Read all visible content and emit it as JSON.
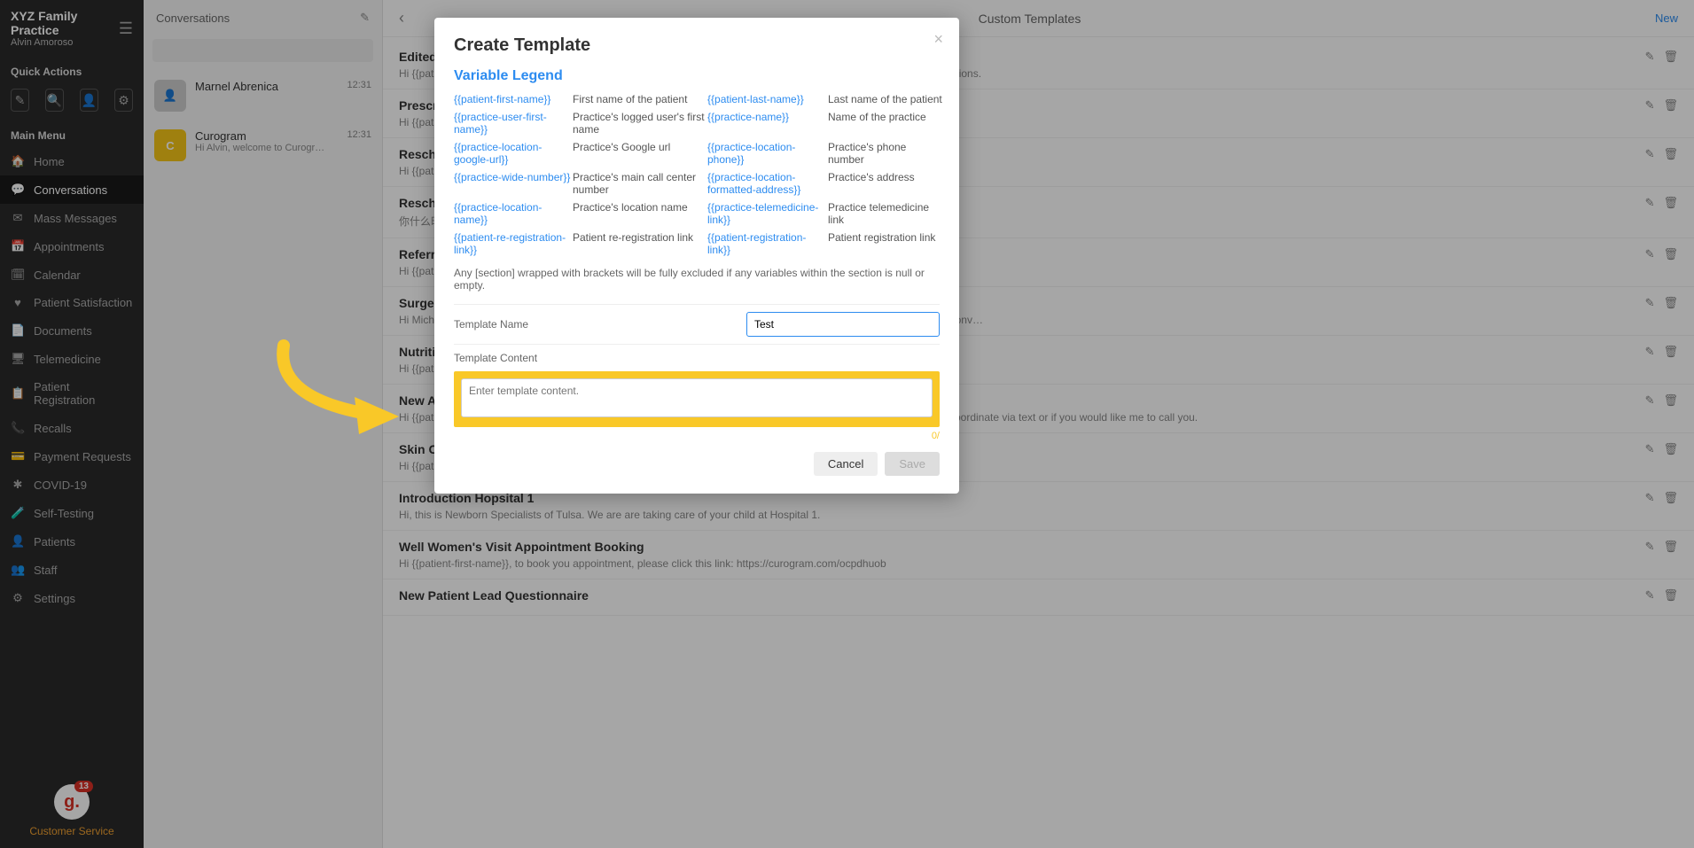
{
  "sidebar": {
    "practice": "XYZ Family Practice",
    "user": "Alvin Amoroso",
    "quick_actions_label": "Quick Actions",
    "main_menu_label": "Main Menu",
    "items": [
      {
        "icon": "🏠",
        "label": "Home"
      },
      {
        "icon": "💬",
        "label": "Conversations"
      },
      {
        "icon": "✉",
        "label": "Mass Messages"
      },
      {
        "icon": "📅",
        "label": "Appointments"
      },
      {
        "icon": "🗓",
        "label": "Calendar"
      },
      {
        "icon": "♥",
        "label": "Patient Satisfaction"
      },
      {
        "icon": "📄",
        "label": "Documents"
      },
      {
        "icon": "🖥",
        "label": "Telemedicine"
      },
      {
        "icon": "📋",
        "label": "Patient Registration"
      },
      {
        "icon": "📞",
        "label": "Recalls"
      },
      {
        "icon": "💳",
        "label": "Payment Requests"
      },
      {
        "icon": "✱",
        "label": "COVID-19"
      },
      {
        "icon": "🧪",
        "label": "Self-Testing"
      },
      {
        "icon": "👤",
        "label": "Patients"
      },
      {
        "icon": "👥",
        "label": "Staff"
      },
      {
        "icon": "⚙",
        "label": "Settings"
      }
    ],
    "badge_count": "13",
    "cs_label": "Customer Service"
  },
  "conversations": {
    "title": "Conversations",
    "search_placeholder": "",
    "items": [
      {
        "name": "Marnel Abrenica",
        "snippet": "",
        "time": "12:31",
        "avatar_type": "photo"
      },
      {
        "name": "Curogram",
        "snippet": "Hi Alvin, welcome to Curogr…",
        "time": "12:31",
        "avatar_type": "yellow",
        "avatar_letter": "C"
      }
    ]
  },
  "main": {
    "title": "Custom Templates",
    "new_label": "New"
  },
  "templates": [
    {
      "title": "Edited T",
      "preview": "Hi {{patient… reply back to this message if you have any questions. Please reply to this message if you have any questions."
    },
    {
      "title": "Prescri",
      "preview": "Hi {{patie…"
    },
    {
      "title": "Resched",
      "preview": "Hi {{patie…"
    },
    {
      "title": "Resched",
      "preview": "你什么时…"
    },
    {
      "title": "Referral",
      "preview": "Hi {{patie…"
    },
    {
      "title": "Surgery",
      "preview": "Hi Michae… …ole is $XXX, and your out-of-pocket is $XXX. I will be sending you a payment request via text for your conv…"
    },
    {
      "title": "Nutritio",
      "preview": "Hi {{patie…"
    },
    {
      "title": "New Ap",
      "preview": "Hi {{patient-first-name}}, Dr. Mote would like you to schedule an appointment. Please let me know if you would like to coordinate via text or if you would like me to call you."
    },
    {
      "title": "Skin Care Post Visit Instructions",
      "preview": "Hi {{patient-first-name}}, please see the link here for instructions on your skin care: WWW"
    },
    {
      "title": "Introduction Hopsital 1",
      "preview": "Hi, this is Newborn Specialists of Tulsa. We are are taking care of your child at Hospital 1."
    },
    {
      "title": "Well Women's Visit Appointment Booking",
      "preview": "Hi {{patient-first-name}}, to book you appointment, please click this link:  https://curogram.com/ocpdhuob"
    },
    {
      "title": "New Patient Lead Questionnaire",
      "preview": ""
    }
  ],
  "modal": {
    "title": "Create Template",
    "legend_title": "Variable Legend",
    "variables": [
      {
        "key": "{{patient-first-name}}",
        "desc": "First name of the patient"
      },
      {
        "key": "{{patient-last-name}}",
        "desc": "Last name of the patient"
      },
      {
        "key": "{{practice-user-first-name}}",
        "desc": "Practice's logged user's first name"
      },
      {
        "key": "{{practice-name}}",
        "desc": "Name of the practice"
      },
      {
        "key": "{{practice-location-google-url}}",
        "desc": "Practice's Google url"
      },
      {
        "key": "{{practice-location-phone}}",
        "desc": "Practice's phone number"
      },
      {
        "key": "{{practice-wide-number}}",
        "desc": "Practice's main call center number"
      },
      {
        "key": "{{practice-location-formatted-address}}",
        "desc": "Practice's address"
      },
      {
        "key": "{{practice-location-name}}",
        "desc": "Practice's location name"
      },
      {
        "key": "{{practice-telemedicine-link}}",
        "desc": "Practice telemedicine link"
      },
      {
        "key": "{{patient-re-registration-link}}",
        "desc": "Patient re-registration link"
      },
      {
        "key": "{{patient-registration-link}}",
        "desc": "Patient registration link"
      }
    ],
    "legend_note": "Any [section] wrapped with brackets will be fully excluded if any variables within the section is null or empty.",
    "template_name_label": "Template Name",
    "template_name_value": "Test",
    "template_content_label": "Template Content",
    "template_content_placeholder": "Enter template content.",
    "char_count": "0/",
    "cancel_label": "Cancel",
    "save_label": "Save"
  }
}
